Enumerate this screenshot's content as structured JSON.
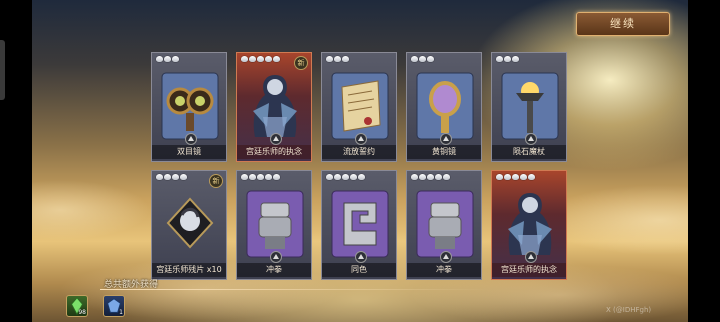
{
  "header": {
    "continue_label": "继续"
  },
  "cards": [
    {
      "name": "双目镜",
      "stars": 3,
      "style": "normal",
      "new": false,
      "icon": "binoculars-icon"
    },
    {
      "name": "宫廷乐师的执念",
      "stars": 5,
      "style": "red",
      "new": true,
      "icon": "court-musician-portrait"
    },
    {
      "name": "流放誓约",
      "stars": 3,
      "style": "normal",
      "new": false,
      "icon": "scroll-icon"
    },
    {
      "name": "黄铜镜",
      "stars": 3,
      "style": "normal",
      "new": false,
      "icon": "mirror-icon"
    },
    {
      "name": "陨石魔杖",
      "stars": 3,
      "style": "normal",
      "new": false,
      "icon": "meteor-staff-icon"
    },
    {
      "name": "宫廷乐师残片 x10",
      "stars": 4,
      "style": "normal",
      "new": true,
      "icon": "musician-fragment-icon"
    },
    {
      "name": "冲拳",
      "stars": 5,
      "style": "purple",
      "new": false,
      "icon": "gauntlet-icon"
    },
    {
      "name": "同色",
      "stars": 5,
      "style": "purple",
      "new": false,
      "icon": "swirl-stone-icon"
    },
    {
      "name": "冲拳",
      "stars": 5,
      "style": "purple",
      "new": false,
      "icon": "gauntlet-icon"
    },
    {
      "name": "宫廷乐师的执念",
      "stars": 5,
      "style": "red",
      "new": false,
      "icon": "court-musician-portrait"
    }
  ],
  "bonus": {
    "label": "总共额外获得",
    "rewards": [
      {
        "name": "green-crystal",
        "count": "98"
      },
      {
        "name": "blue-crest",
        "count": "1"
      }
    ]
  },
  "watermark": "X (@IDHFgh)",
  "new_badge_text": "新",
  "colors": {
    "card_border": "#8a8a96",
    "red_card": "#a8452c",
    "button": "#8a5a34"
  }
}
